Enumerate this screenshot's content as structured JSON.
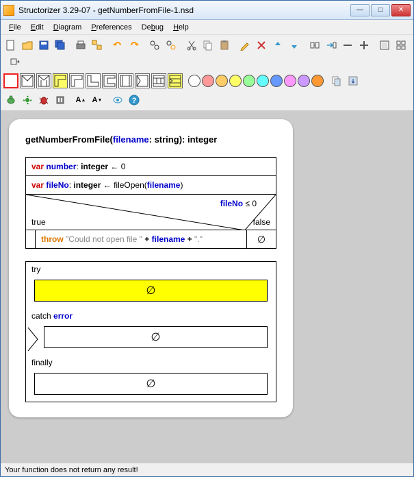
{
  "window": {
    "title": "Structorizer 3.29-07 - getNumberFromFile-1.nsd"
  },
  "menu": {
    "file": "File",
    "edit": "Edit",
    "diagram": "Diagram",
    "preferences": "Preferences",
    "debug": "Debug",
    "help": "Help"
  },
  "colors": [
    "#ffffff",
    "#ff6666",
    "#ffcc66",
    "#ffff66",
    "#99ff99",
    "#66ffff",
    "#6699ff",
    "#ff99ff",
    "#cc99ff",
    "#ff9933"
  ],
  "nsd": {
    "header": {
      "func": "getNumberFromFile",
      "param": "filename",
      "ptype": "string",
      "rtype": "integer"
    },
    "row1": {
      "var": "var",
      "name": "number",
      "type": "integer",
      "assign": "← 0"
    },
    "row2": {
      "var": "var",
      "name": "fileNo",
      "type": "integer",
      "assign": "← fileOpen(",
      "arg": "filename",
      "close": ")"
    },
    "alt": {
      "cond_name": "fileNo",
      "cond_op": "≤ 0",
      "true": "true",
      "false": "false",
      "throw": "throw",
      "msg1": "\"Could not open file \"",
      "plus1": "+",
      "argname": "filename",
      "plus2": "+",
      "msg2": "\".\"",
      "empty_false": "∅"
    },
    "try": {
      "try_label": "try",
      "try_empty": "∅",
      "catch_label": "catch",
      "catch_var": "error",
      "catch_empty": "∅",
      "finally_label": "finally",
      "finally_empty": "∅"
    }
  },
  "status": "Your function does not return any result!"
}
